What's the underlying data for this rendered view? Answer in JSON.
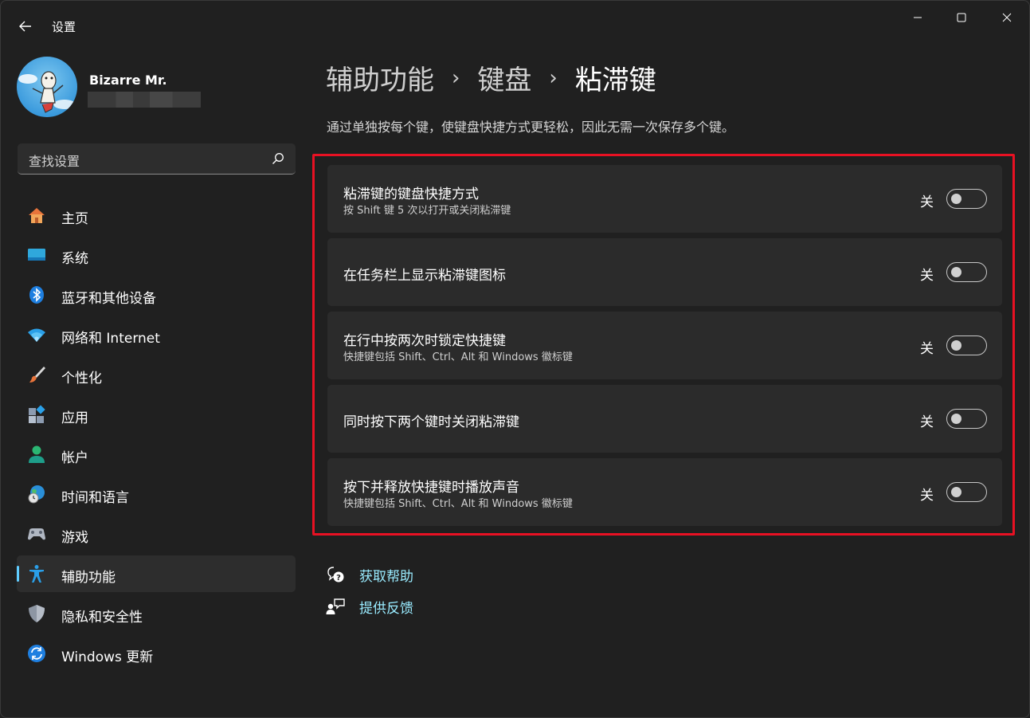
{
  "window": {
    "title": "设置"
  },
  "profile": {
    "name": "Bizarre Mr."
  },
  "search": {
    "placeholder": "查找设置"
  },
  "sidebar": {
    "items": [
      {
        "label": "主页",
        "icon": "home-icon"
      },
      {
        "label": "系统",
        "icon": "system-icon"
      },
      {
        "label": "蓝牙和其他设备",
        "icon": "bluetooth-icon"
      },
      {
        "label": "网络和 Internet",
        "icon": "wifi-icon"
      },
      {
        "label": "个性化",
        "icon": "brush-icon"
      },
      {
        "label": "应用",
        "icon": "apps-icon"
      },
      {
        "label": "帐户",
        "icon": "account-icon"
      },
      {
        "label": "时间和语言",
        "icon": "time-language-icon"
      },
      {
        "label": "游戏",
        "icon": "gaming-icon"
      },
      {
        "label": "辅助功能",
        "icon": "accessibility-icon",
        "active": true
      },
      {
        "label": "隐私和安全性",
        "icon": "shield-icon"
      },
      {
        "label": "Windows 更新",
        "icon": "update-icon"
      }
    ]
  },
  "breadcrumb": {
    "items": [
      "辅助功能",
      "键盘",
      "粘滞键"
    ],
    "separator": "›"
  },
  "description": "通过单独按每个键，使键盘快捷方式更轻松，因此无需一次保存多个键。",
  "settings": [
    {
      "title": "粘滞键的键盘快捷方式",
      "subtitle": "按 Shift 键 5 次以打开或关闭粘滞键",
      "state": "关",
      "on": false
    },
    {
      "title": "在任务栏上显示粘滞键图标",
      "subtitle": "",
      "state": "关",
      "on": false
    },
    {
      "title": "在行中按两次时锁定快捷键",
      "subtitle": "快捷键包括 Shift、Ctrl、Alt 和 Windows 徽标键",
      "state": "关",
      "on": false
    },
    {
      "title": "同时按下两个键时关闭粘滞键",
      "subtitle": "",
      "state": "关",
      "on": false
    },
    {
      "title": "按下并释放快捷键时播放声音",
      "subtitle": "快捷键包括 Shift、Ctrl、Alt 和 Windows 徽标键",
      "state": "关",
      "on": false
    }
  ],
  "links": {
    "help": "获取帮助",
    "feedback": "提供反馈"
  },
  "colors": {
    "accent": "#60cdff",
    "link": "#99ebff",
    "highlight_border": "#e81123",
    "background": "#202020",
    "card": "#2b2b2b"
  }
}
